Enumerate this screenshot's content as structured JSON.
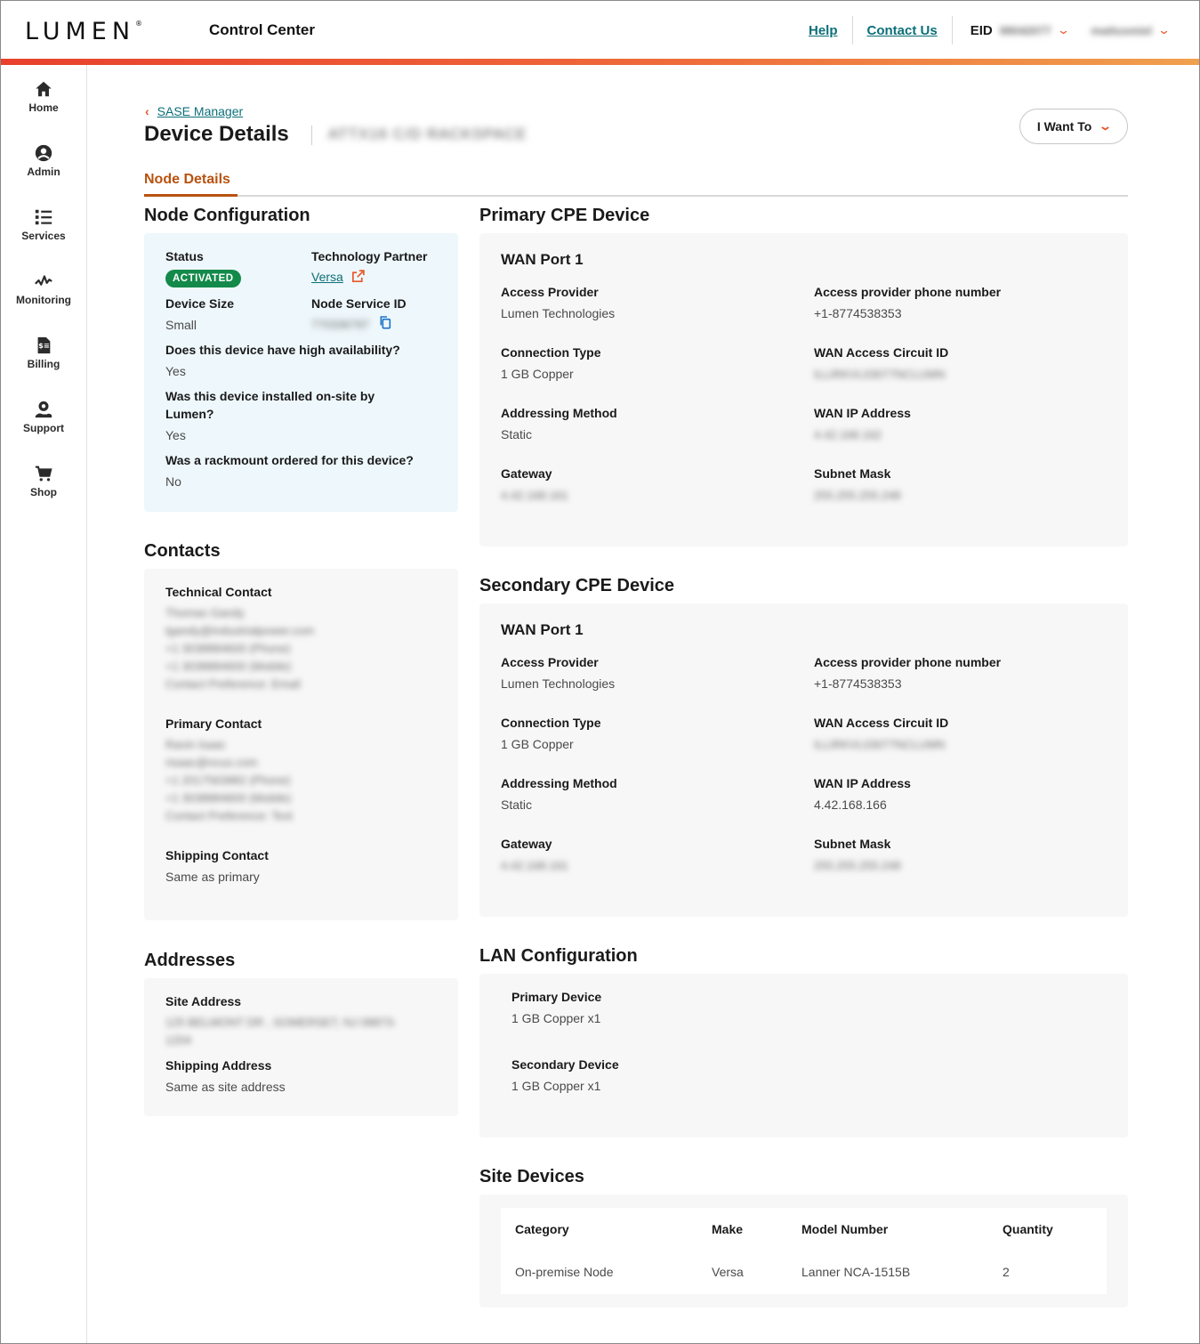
{
  "header": {
    "logo": "LUMEN",
    "app_title": "Control Center",
    "help": "Help",
    "contact_us": "Contact Us",
    "eid_label": "EID",
    "eid_value": "99042077",
    "user": "mattusmiel"
  },
  "nav": [
    {
      "label": "Home",
      "icon": "home-icon"
    },
    {
      "label": "Admin",
      "icon": "admin-icon"
    },
    {
      "label": "Services",
      "icon": "services-icon"
    },
    {
      "label": "Monitoring",
      "icon": "monitoring-icon"
    },
    {
      "label": "Billing",
      "icon": "billing-icon"
    },
    {
      "label": "Support",
      "icon": "support-icon"
    },
    {
      "label": "Shop",
      "icon": "shop-icon"
    }
  ],
  "breadcrumb": "SASE Manager",
  "page": {
    "title": "Device Details",
    "subtitle": "ATTX16 C/D RACKSPACE",
    "i_want_to": "I Want To",
    "tab": "Node Details"
  },
  "node_config": {
    "title": "Node Configuration",
    "status_label": "Status",
    "status_value": "ACTIVATED",
    "partner_label": "Technology Partner",
    "partner_value": "Versa",
    "size_label": "Device Size",
    "size_value": "Small",
    "service_id_label": "Node Service ID",
    "service_id_value": "770336797",
    "ha_label": "Does this device have high availability?",
    "ha_value": "Yes",
    "installed_label_1": "Was this device installed on-site by",
    "installed_label_2": "Lumen?",
    "installed_value": "Yes",
    "rack_label": "Was a rackmount ordered for this device?",
    "rack_value": "No"
  },
  "contacts": {
    "title": "Contacts",
    "technical_label": "Technical Contact",
    "technical_lines": [
      "Thomas Gandy",
      "tgandy@industrialpower.com",
      "+1 3038884600 (Phone)",
      "+1 3038884600 (Mobile)",
      "Contact Preference: Email"
    ],
    "primary_label": "Primary Contact",
    "primary_lines": [
      "Ravin Isaac",
      "risaac@ncus.com",
      "+1 2017563982 (Phone)",
      "+1 3038884600 (Mobile)",
      "Contact Preference: Text"
    ],
    "shipping_label": "Shipping Contact",
    "shipping_value": "Same as primary"
  },
  "addresses": {
    "title": "Addresses",
    "site_label": "Site Address",
    "site_lines": [
      "125 BELMONT DR , SOMERSET, NJ 08873-",
      "1204"
    ],
    "shipping_label": "Shipping Address",
    "shipping_value": "Same as site address"
  },
  "primary_cpe": {
    "title": "Primary CPE Device",
    "port": "WAN Port 1",
    "access_provider_label": "Access Provider",
    "access_provider": "Lumen Technologies",
    "phone_label": "Access provider phone number",
    "phone": "+1-8774538353",
    "conn_type_label": "Connection Type",
    "conn_type": "1 GB Copper",
    "circuit_label": "WAN Access Circuit ID",
    "circuit": "ILLIRKVL03077NCLUMN",
    "addr_method_label": "Addressing Method",
    "addr_method": "Static",
    "wan_ip_label": "WAN IP Address",
    "wan_ip": "4.42.168.162",
    "gateway_label": "Gateway",
    "gateway": "4.42.168.161",
    "subnet_label": "Subnet Mask",
    "subnet": "255.255.255.248"
  },
  "secondary_cpe": {
    "title": "Secondary CPE Device",
    "port": "WAN Port 1",
    "access_provider_label": "Access Provider",
    "access_provider": "Lumen Technologies",
    "phone_label": "Access provider phone number",
    "phone": "+1-8774538353",
    "conn_type_label": "Connection Type",
    "conn_type": "1 GB Copper",
    "circuit_label": "WAN Access Circuit ID",
    "circuit": "ILLIRKVL03077NCLUMN",
    "addr_method_label": "Addressing Method",
    "addr_method": "Static",
    "wan_ip_label": "WAN IP Address",
    "wan_ip": "4.42.168.166",
    "gateway_label": "Gateway",
    "gateway": "4.42.168.161",
    "subnet_label": "Subnet Mask",
    "subnet": "255.255.255.248"
  },
  "lan": {
    "title": "LAN Configuration",
    "primary_label": "Primary Device",
    "primary_value": "1 GB Copper x1",
    "secondary_label": "Secondary Device",
    "secondary_value": "1 GB Copper x1"
  },
  "site_devices": {
    "title": "Site Devices",
    "columns": [
      "Category",
      "Make",
      "Model Number",
      "Quantity"
    ],
    "rows": [
      [
        "On-premise Node",
        "Versa",
        "Lanner NCA-1515B",
        "2"
      ]
    ]
  },
  "colors": {
    "accent": "#e8582c",
    "link": "#0b6f78",
    "tab_active": "#b9520f",
    "badge": "#138a4a"
  }
}
